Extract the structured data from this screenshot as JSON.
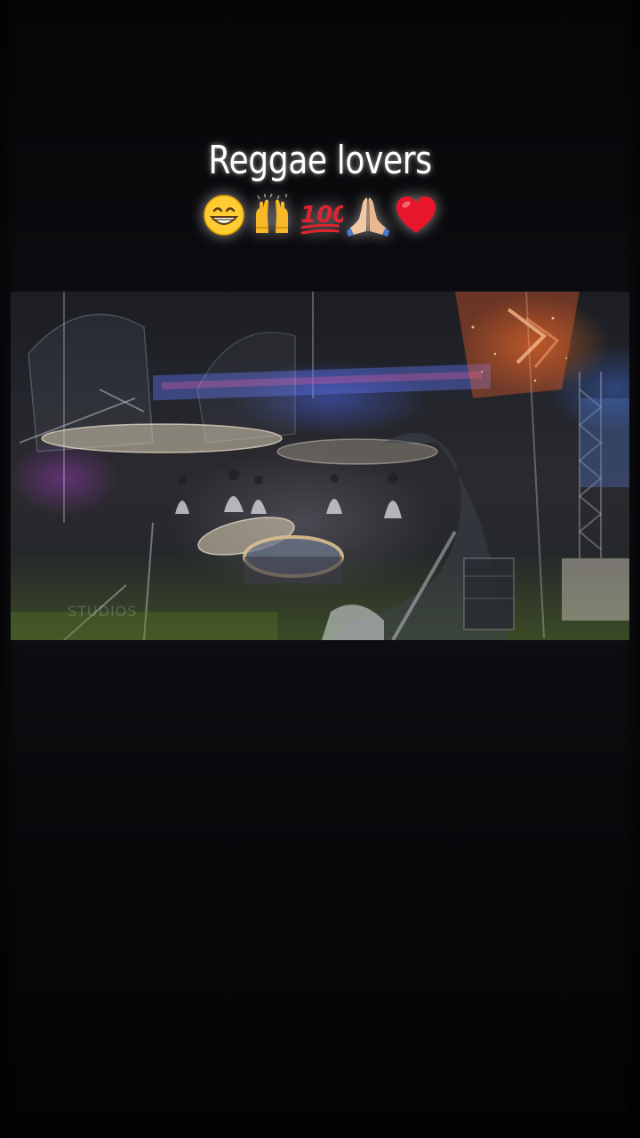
{
  "caption": {
    "title": "Reggae lovers",
    "emojis": [
      "grinning-face-emoji",
      "raising-hands-emoji",
      "hundred-points-emoji",
      "folded-hands-emoji",
      "red-heart-emoji"
    ]
  },
  "video": {
    "description_icon": "video-frame",
    "watermark": "STUDIOS"
  },
  "colors": {
    "background": "#0c0c10",
    "caption_text": "#ffffff",
    "stage_orange": "#ff7828",
    "stage_blue": "#506eff"
  }
}
